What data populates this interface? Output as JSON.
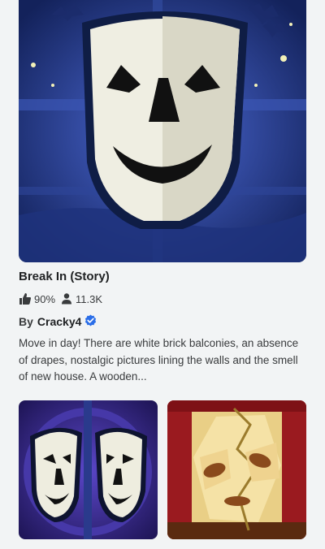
{
  "game": {
    "title": "Break In (Story)",
    "rating": "90%",
    "players": "11.3K",
    "by_label": "By",
    "creator": "Cracky4",
    "description": "Move in day! There are white brick balconies, an absence of drapes, nostalgic pictures lining the walls and the smell of new house. A wooden..."
  },
  "icons": {
    "rating": "thumbs-up-icon",
    "players": "players-icon",
    "verified": "verified-badge-icon"
  },
  "colors": {
    "verified": "#2b6ee8",
    "hero_bg": "#243a86",
    "thumb1_bg": "#2a1f74",
    "thumb2_bg": "#c7262b"
  }
}
